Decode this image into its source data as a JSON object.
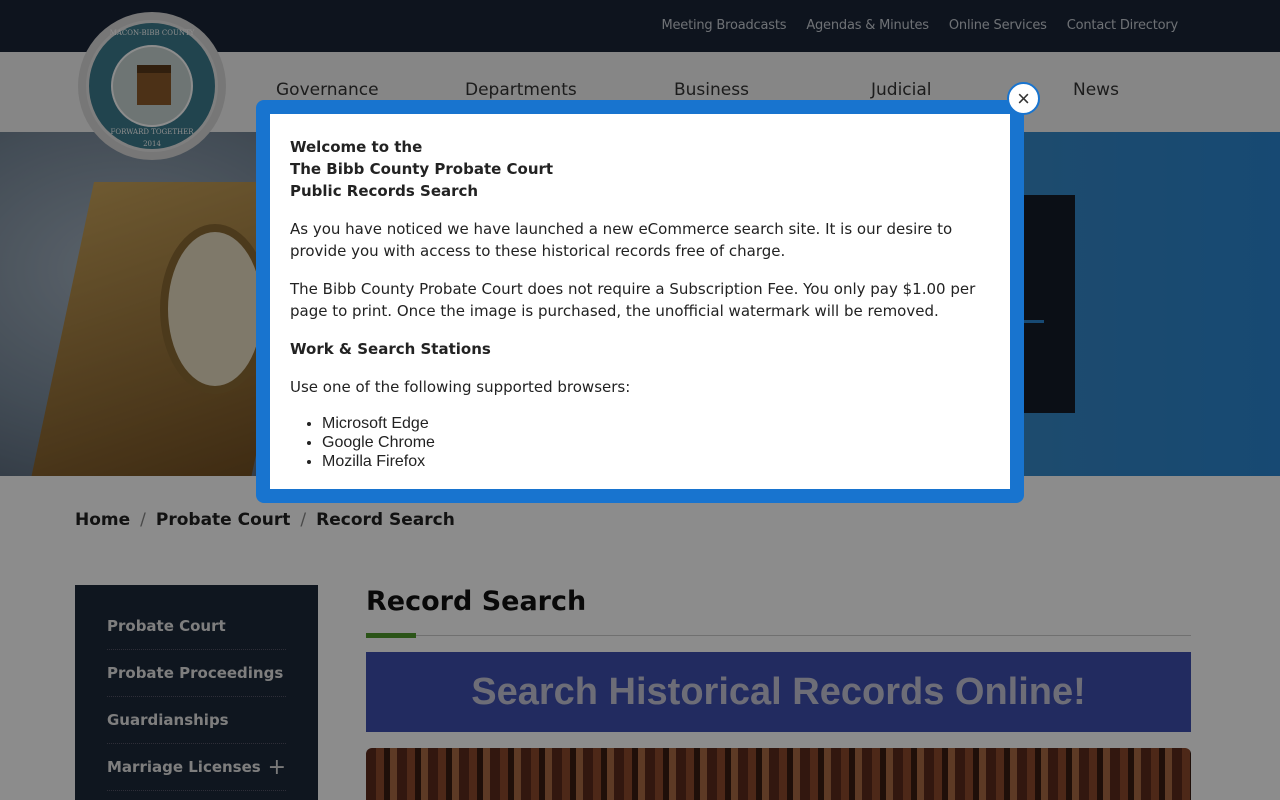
{
  "top_links": [
    "Meeting Broadcasts",
    "Agendas & Minutes",
    "Online Services",
    "Contact Directory"
  ],
  "nav": [
    "Governance",
    "Departments",
    "Business",
    "Judicial",
    "News"
  ],
  "seal": {
    "top_text": "MACON-BIBB COUNTY",
    "motto": "FORWARD TOGETHER",
    "year": "2014",
    "left_year": "1823",
    "right_year": "1823"
  },
  "breadcrumb": [
    "Home",
    "Probate Court",
    "Record Search"
  ],
  "sidebar": [
    "Probate Court",
    "Probate Proceedings",
    "Guardianships",
    "Marriage Licenses"
  ],
  "main": {
    "title": "Record Search",
    "banner": "Search Historical Records Online!"
  },
  "modal": {
    "heading_line1": "Welcome to the",
    "heading_line2": "The Bibb County Probate Court",
    "heading_line3": "Public Records Search",
    "para1": "As you have noticed we have launched a new eCommerce search site.  It is our desire to provide you with access to these historical records free of charge.",
    "para2": "The Bibb County Probate Court does not require a Subscription Fee. You only pay $1.00 per page to print. Once the image is purchased, the unofficial watermark will be removed.",
    "section_title": "Work & Search Stations",
    "browsers_intro": "Use one of the following supported browsers:",
    "browsers": [
      "Microsoft Edge",
      "Google Chrome",
      "Mozilla Firefox"
    ],
    "close_icon": "×"
  }
}
